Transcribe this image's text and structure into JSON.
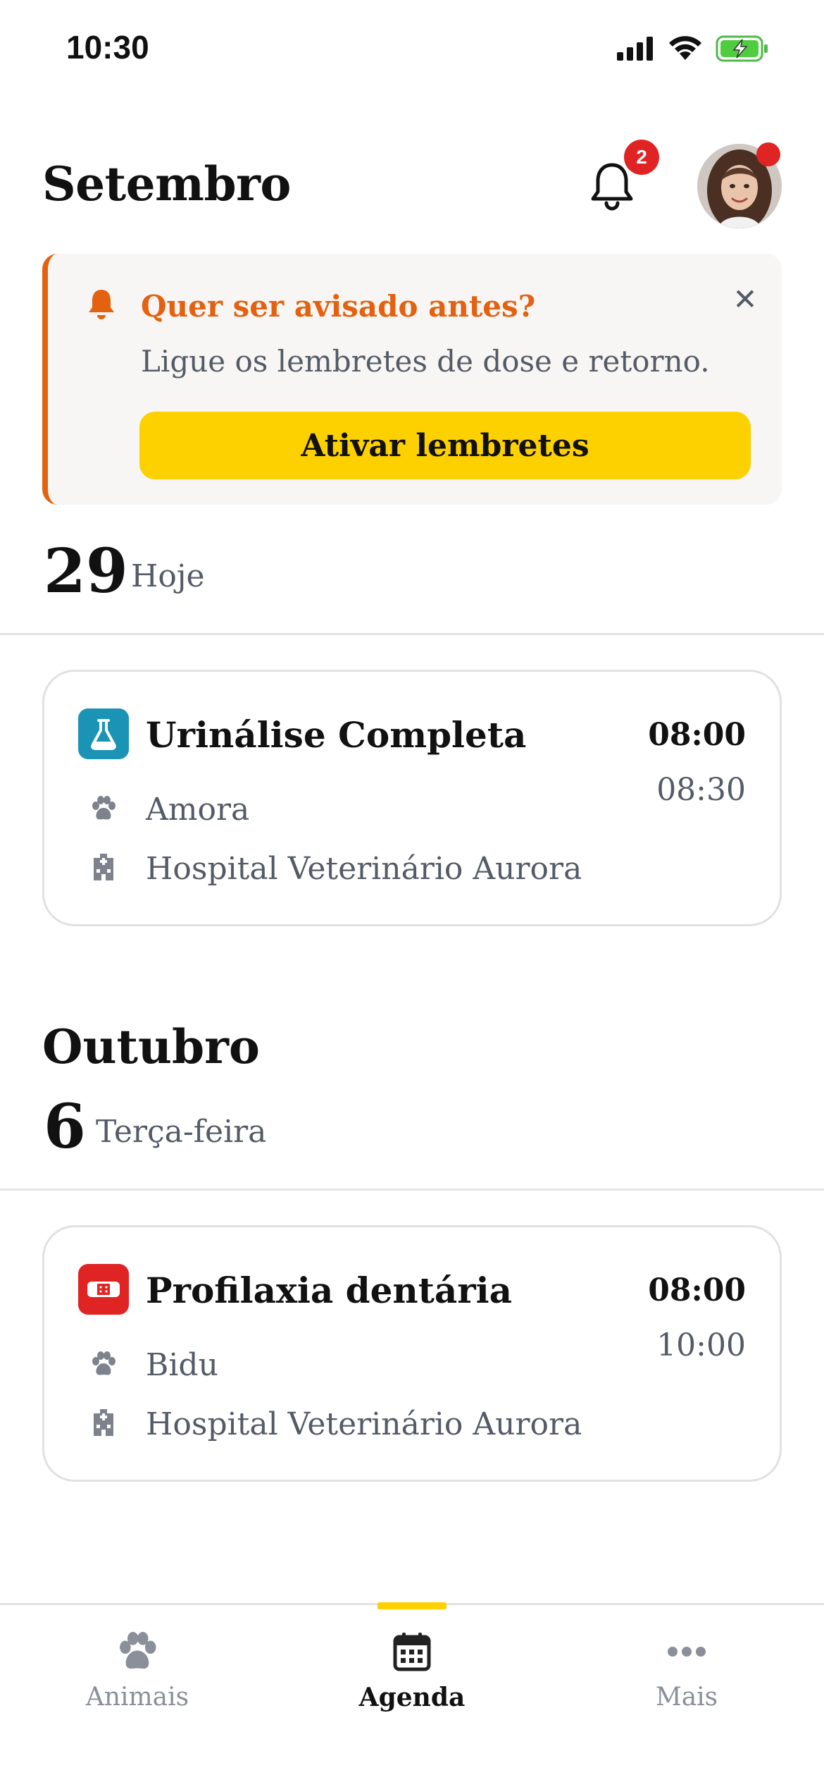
{
  "status_bar": {
    "time": "10:30"
  },
  "header": {
    "month": "Setembro",
    "notification_count": "2"
  },
  "banner": {
    "title": "Quer ser avisado antes?",
    "text": "Ligue os lembretes de dose e retorno.",
    "button": "Ativar lembretes",
    "accent_color": "#e4610f"
  },
  "days": [
    {
      "number": "29",
      "label": "Hoje",
      "event": {
        "title": "Urinálise Completa",
        "start": "08:00",
        "end": "08:30",
        "pet": "Amora",
        "place": "Hospital Veterinário Aurora",
        "icon": "flask-icon",
        "icon_color": "#1b93b4"
      }
    },
    {
      "section_month": "Outubro",
      "number": "6",
      "label": "Terça-feira",
      "event": {
        "title": "Profilaxia dentária",
        "start": "08:00",
        "end": "10:00",
        "pet": "Bidu",
        "place": "Hospital Veterinário Aurora",
        "icon": "bandage-icon",
        "icon_color": "#e02424"
      }
    }
  ],
  "tabbar": {
    "tabs": [
      {
        "label": "Animais",
        "icon": "paw-icon"
      },
      {
        "label": "Agenda",
        "icon": "calendar-icon",
        "active": true
      },
      {
        "label": "Mais",
        "icon": "more-icon"
      }
    ],
    "active_color": "#fdd000"
  }
}
